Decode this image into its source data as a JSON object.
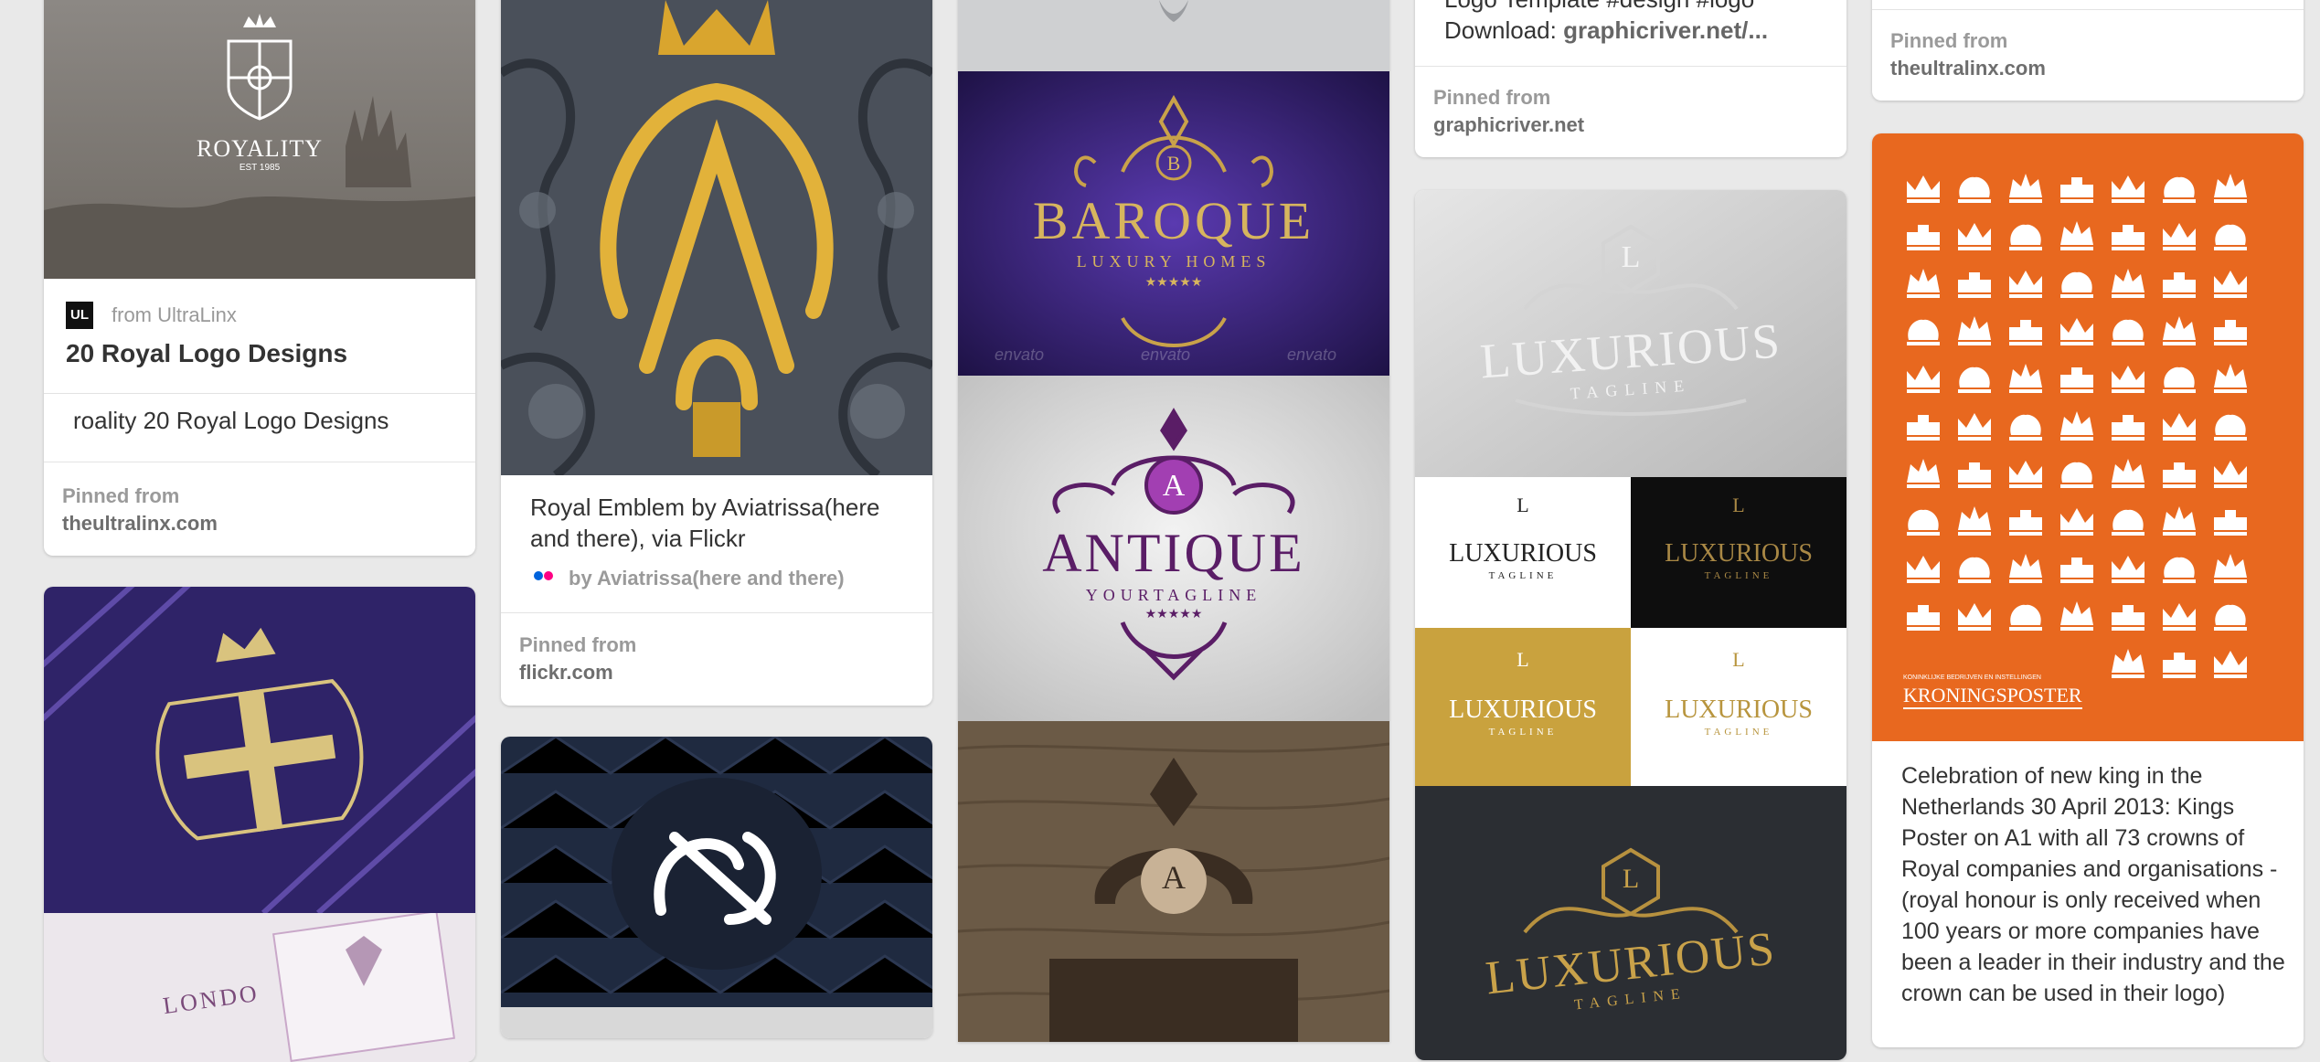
{
  "cards": {
    "royality": {
      "logo_text": "ROYALITY",
      "logo_sub": "EST 1985",
      "source_icon": "UL",
      "from": "from UltraLinx",
      "title": "20 Royal Logo Designs",
      "description": "roality 20 Royal Logo Designs",
      "pinned_label": "Pinned from",
      "pinned_domain": "theultralinx.com"
    },
    "royal_emblem": {
      "description": "Royal Emblem by Aviatrissa(here and there), via Flickr",
      "byline": "by Aviatrissa(here and there)",
      "source_icon": "flickr-icon",
      "pinned_label": "Pinned from",
      "pinned_domain": "flickr.com"
    },
    "logo_template": {
      "description_line1": "Logo Template #design #logo",
      "description_line2_prefix": "Download: ",
      "description_line2_link": "graphicriver.net/...",
      "pinned_label": "Pinned from",
      "pinned_domain": "graphicriver.net"
    },
    "top_right": {
      "pinned_label": "Pinned from",
      "pinned_domain": "theultralinx.com"
    },
    "kings_poster": {
      "poster_caption_small": "KONINKLIJKE BEDRIJVEN EN INSTELLINGEN",
      "poster_title": "KRONINGSPOSTER",
      "description": "Celebration of new king in the Netherlands 30 April 2013: Kings Poster on A1 with all 73 crowns of Royal companies and organisations - (royal honour is only received when 100 years or more companies have been a leader in their industry and the crown can be used in their logo)"
    }
  },
  "logos": {
    "baroque": {
      "title": "BAROQUE",
      "subtitle": "LUXURY HOMES",
      "initial": "B",
      "stars": "★★★★★"
    },
    "antique": {
      "title": "ANTIQUE",
      "subtitle": "YOURTAGLINE",
      "initial": "A",
      "stars": "★★★★★"
    },
    "luxurious": {
      "title": "LUXURIOUS",
      "subtitle": "TAGLINE",
      "initial": "L"
    },
    "london": {
      "text": "LONDO"
    },
    "wood_initial": "A",
    "watermark": "envato"
  },
  "colors": {
    "background": "#e9e9e9",
    "card": "#ffffff",
    "poster_orange": "#e8681f",
    "purple_bg": "#3a2a7a",
    "gold": "#c9a24a"
  }
}
